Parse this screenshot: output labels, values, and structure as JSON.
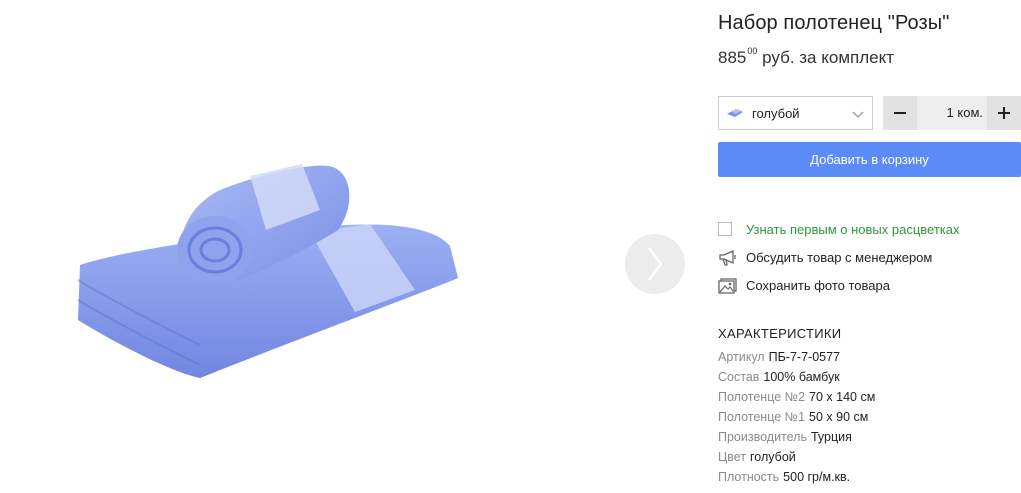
{
  "product": {
    "title": "Набор полотенец \"Розы\"",
    "price_main": "885",
    "price_cents": "00",
    "price_unit": "руб. за комплект"
  },
  "gallery": {
    "image_icon": "rolled-blue-towel-image",
    "next_icon": "chevron-right-icon"
  },
  "variant": {
    "selected_color": "голубой",
    "swatch_icon": "towel-swatch-icon",
    "dropdown_icon": "chevron-down-icon"
  },
  "quantity": {
    "value": "1",
    "unit": "ком.",
    "minus_icon": "minus-icon",
    "plus_icon": "plus-icon"
  },
  "cart": {
    "label": "Добавить в корзину"
  },
  "actions": {
    "notify_label": "Узнать первым о новых расцветках",
    "discuss_label": "Обсудить товар с менеджером",
    "save_photo_label": "Сохранить фото товара"
  },
  "specs": {
    "title": "ХАРАКТЕРИСТИКИ",
    "rows": [
      {
        "label": "Артикул",
        "value": "ПБ-7-7-0577"
      },
      {
        "label": "Состав",
        "value": "100% бамбук"
      },
      {
        "label": "Полотенце №2",
        "value": "70 x 140 см"
      },
      {
        "label": "Полотенце №1",
        "value": "50 x 90 см"
      },
      {
        "label": "Производитель",
        "value": "Турция"
      },
      {
        "label": "Цвет",
        "value": "голубой"
      },
      {
        "label": "Плотность",
        "value": "500 гр/м.кв."
      }
    ]
  },
  "colors": {
    "accent_button": "#5b8bf7",
    "notify_green": "#2b9a36",
    "towel_blue": "#8aa0f0"
  }
}
